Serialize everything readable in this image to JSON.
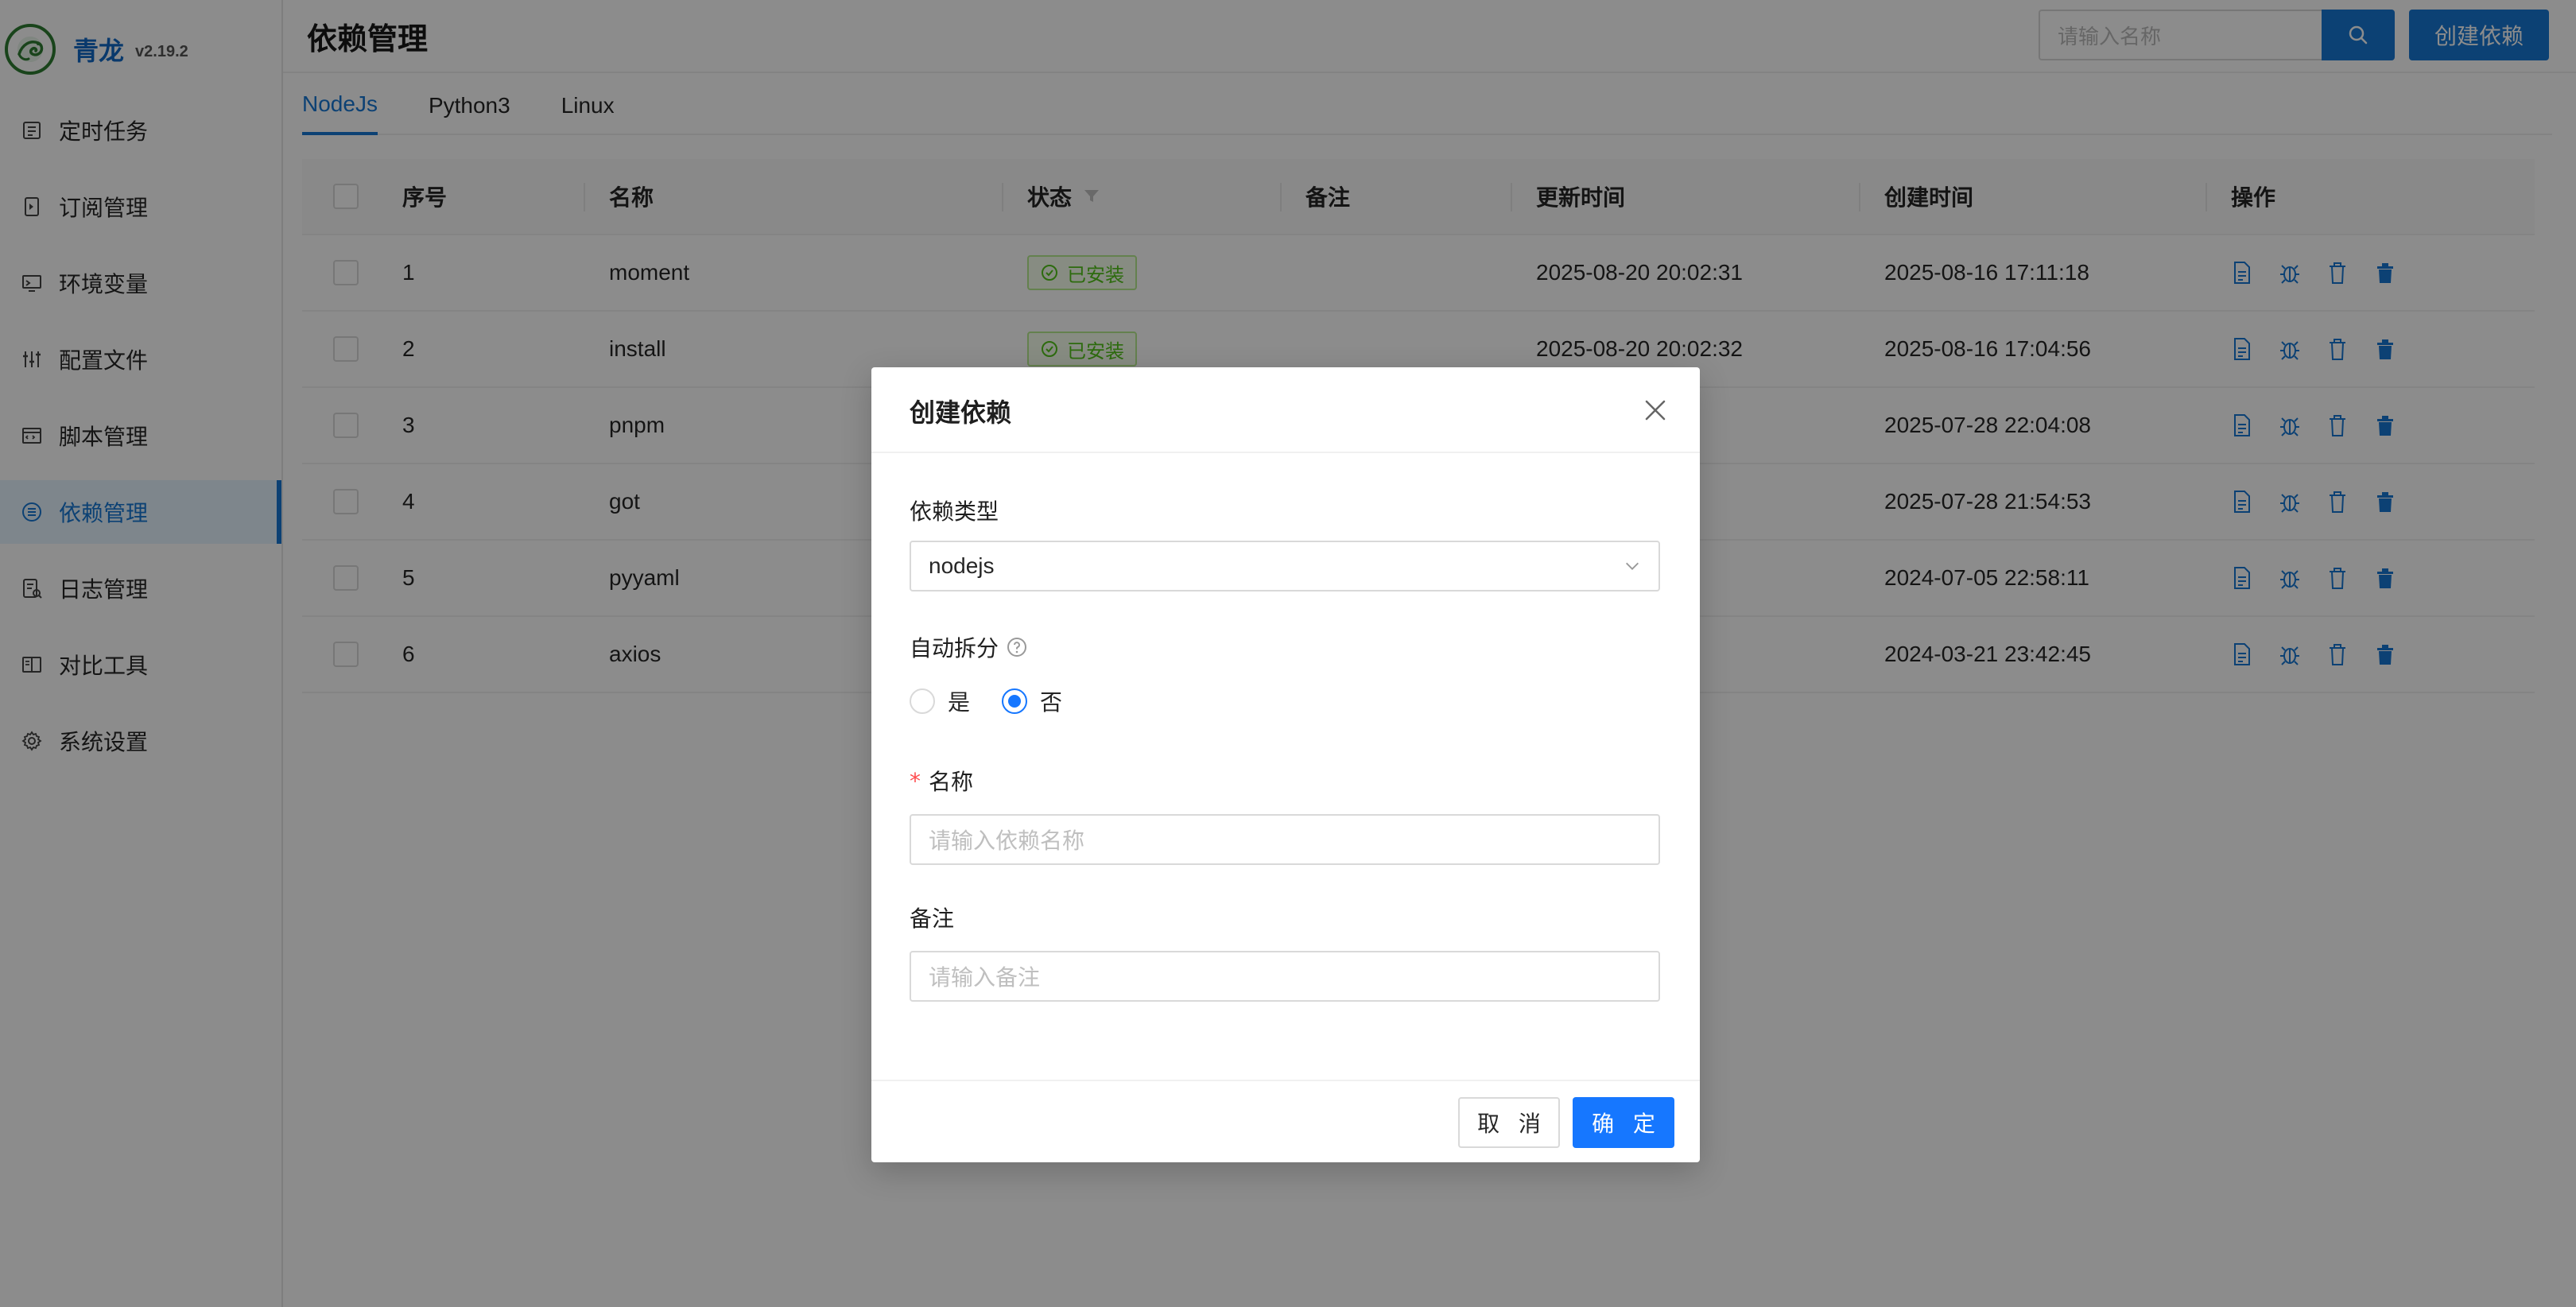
{
  "app": {
    "name": "青龙",
    "version": "v2.19.2"
  },
  "sidebar": {
    "items": [
      {
        "label": "定时任务",
        "icon": "calendar-icon"
      },
      {
        "label": "订阅管理",
        "icon": "subscription-icon"
      },
      {
        "label": "环境变量",
        "icon": "monitor-icon"
      },
      {
        "label": "配置文件",
        "icon": "sliders-icon"
      },
      {
        "label": "脚本管理",
        "icon": "code-icon"
      },
      {
        "label": "依赖管理",
        "icon": "list-icon",
        "active": true
      },
      {
        "label": "日志管理",
        "icon": "log-icon"
      },
      {
        "label": "对比工具",
        "icon": "diff-icon"
      },
      {
        "label": "系统设置",
        "icon": "gear-icon"
      }
    ]
  },
  "header": {
    "title": "依赖管理",
    "search_placeholder": "请输入名称",
    "create_label": "创建依赖"
  },
  "tabs": [
    {
      "label": "NodeJs",
      "active": true
    },
    {
      "label": "Python3"
    },
    {
      "label": "Linux"
    }
  ],
  "table": {
    "columns": [
      "序号",
      "名称",
      "状态",
      "备注",
      "更新时间",
      "创建时间",
      "操作"
    ],
    "rows": [
      {
        "index": "1",
        "name": "moment",
        "status": "已安装",
        "remark": "",
        "updated": "2025-08-20 20:02:31",
        "created": "2025-08-16 17:11:18"
      },
      {
        "index": "2",
        "name": "install",
        "status": "已安装",
        "remark": "",
        "updated": "2025-08-20 20:02:32",
        "created": "2025-08-16 17:04:56"
      },
      {
        "index": "3",
        "name": "pnpm",
        "status": "",
        "remark": "",
        "updated": "0:02:32",
        "created": "2025-07-28 22:04:08"
      },
      {
        "index": "4",
        "name": "got",
        "status": "",
        "remark": "",
        "updated": "0:02:32",
        "created": "2025-07-28 21:54:53"
      },
      {
        "index": "5",
        "name": "pyyaml",
        "status": "",
        "remark": "",
        "updated": "0:02:33",
        "created": "2024-07-05 22:58:11"
      },
      {
        "index": "6",
        "name": "axios",
        "status": "",
        "remark": "",
        "updated": "0:02:33",
        "created": "2024-03-21 23:42:45"
      }
    ]
  },
  "modal": {
    "title": "创建依赖",
    "type_label": "依赖类型",
    "type_value": "nodejs",
    "split_label": "自动拆分",
    "split_options": [
      "是",
      "否"
    ],
    "split_selected": "否",
    "name_label": "名称",
    "name_placeholder": "请输入依赖名称",
    "remark_label": "备注",
    "remark_placeholder": "请输入备注",
    "cancel_label": "取 消",
    "ok_label": "确 定"
  },
  "colors": {
    "primary": "#1677d3",
    "success": "#52c41a",
    "danger": "#ff4d4f"
  }
}
